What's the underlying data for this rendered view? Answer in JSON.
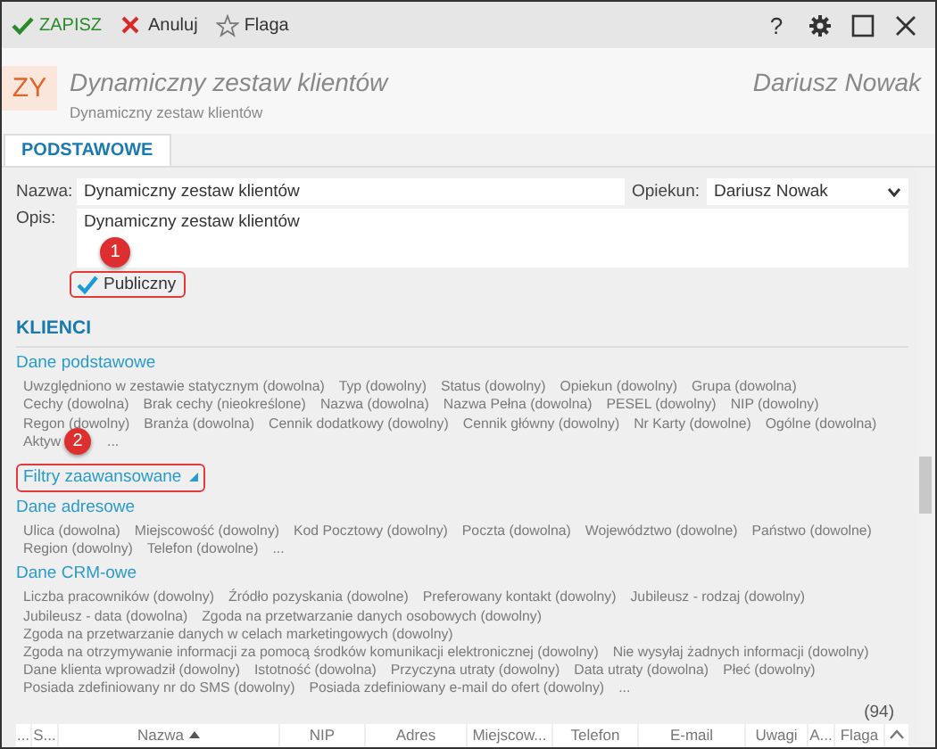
{
  "toolbar": {
    "actions": [
      {
        "kind": "save",
        "label": "ZAPISZ"
      },
      {
        "kind": "cancel",
        "label": "Anuluj"
      },
      {
        "kind": "flag",
        "label": "Flaga"
      }
    ],
    "window_buttons": [
      {
        "kind": "help",
        "label": "?"
      },
      {
        "kind": "settings"
      },
      {
        "kind": "maximize"
      },
      {
        "kind": "close"
      }
    ]
  },
  "header": {
    "avatar": "ZY",
    "title": "Dynamiczny zestaw klientów",
    "subtitle": "Dynamiczny zestaw klientów",
    "owner": "Dariusz Nowak"
  },
  "tabs": [
    {
      "label": "PODSTAWOWE",
      "selected": true
    }
  ],
  "form": {
    "name_label": "Nazwa:",
    "name_value": "Dynamiczny zestaw klientów",
    "owner_label": "Opiekun:",
    "owner_value": "Dariusz Nowak",
    "description_label": "Opis:",
    "description_value": "Dynamiczny zestaw klientów",
    "public": {
      "label": "Publiczny",
      "checked": true,
      "highlighted": true,
      "callout": "1"
    }
  },
  "clients": {
    "title": "KLIENCI",
    "sections": [
      {
        "kind": "group",
        "title": "Dane podstawowe",
        "items": [
          "Uwzględniono w zestawie statycznym (dowolna)",
          "Typ (dowolny)",
          "Status (dowolny)",
          "Opiekun (dowolny)",
          "Grupa (dowolna)",
          "Cechy (dowolna)",
          "Brak cechy (nieokreślone)",
          "Nazwa (dowolna)",
          "Nazwa Pełna (dowolna)",
          "PESEL (dowolny)",
          "NIP (dowolny)",
          "Regon (dowolny)",
          "Branża (dowolna)",
          "Cennik dodatkowy (dowolny)",
          "Cennik główny (dowolny)",
          "Nr Karty (dowolne)",
          "Ogólne (dowolna)",
          "Aktyw"
        ],
        "more": "...",
        "callout": "2"
      },
      {
        "kind": "toggle",
        "title": "Filtry zaawansowane",
        "highlighted": true
      },
      {
        "kind": "group",
        "title": "Dane adresowe",
        "items": [
          "Ulica (dowolna)",
          "Miejscowość (dowolny)",
          "Kod Pocztowy (dowolny)",
          "Poczta (dowolna)",
          "Województwo (dowolne)",
          "Państwo (dowolne)",
          "Region (dowolny)",
          "Telefon (dowolne)"
        ],
        "more": "..."
      },
      {
        "kind": "group",
        "title": "Dane CRM-owe",
        "items": [
          "Liczba pracowników (dowolny)",
          "Źródło pozyskania (dowolne)",
          "Preferowany kontakt (dowolny)",
          "Jubileusz - rodzaj (dowolny)",
          "Jubileusz - data (dowolna)",
          "Zgoda na przetwarzanie danych osobowych (dowolny)",
          "Zgoda na przetwarzanie danych w celach marketingowych (dowolny)",
          "Zgoda na otrzymywanie informacji za pomocą środków komunikacji elektronicznej (dowolny)",
          "Nie wysyłaj żadnych informacji (dowolny)",
          "Dane klienta wprowadził (dowolny)",
          "Istotność (dowolna)",
          "Przyczyna utraty (dowolny)",
          "Data utraty (dowolna)",
          "Płeć (dowolny)",
          "Posiada zdefiniowany nr do SMS (dowolny)",
          "Posiada zdefiniowany e-mail do ofert (dowolny)"
        ],
        "more": "..."
      }
    ],
    "count": "(94)"
  },
  "table": {
    "columns": [
      {
        "label": "..."
      },
      {
        "label": "S..."
      },
      {
        "label": "Nazwa",
        "sorted": true
      },
      {
        "label": "NIP"
      },
      {
        "label": "Adres"
      },
      {
        "label": "Miejscow..."
      },
      {
        "label": "Telefon"
      },
      {
        "label": "E-mail"
      },
      {
        "label": "Uwagi"
      },
      {
        "label": "A..."
      },
      {
        "label": "Flaga"
      }
    ]
  }
}
